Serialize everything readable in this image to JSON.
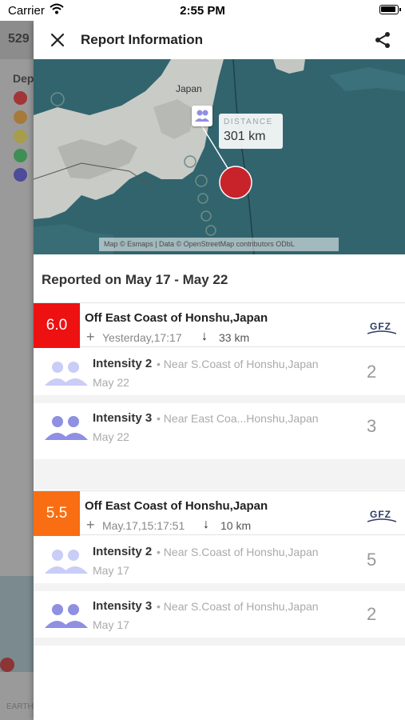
{
  "status_bar": {
    "carrier": "Carrier",
    "time": "2:55 PM"
  },
  "background_app": {
    "count": "529",
    "legend_title": "Dep",
    "legend_colors": [
      "#a23636",
      "#a77a3c",
      "#a79d4a",
      "#3f8e54",
      "#4e4b9a"
    ],
    "footer": "EARTH"
  },
  "header": {
    "title": "Report Information"
  },
  "map": {
    "place_label": "Japan",
    "distance_label": "DISTANCE",
    "distance_value": "301 km",
    "attribution": "Map © Esmaps | Data © OpenStreetMap contributors ODbL"
  },
  "reported_heading": "Reported on May 17 - May 22",
  "colors": {
    "mag_6": "#ee1111",
    "mag_5": "#f96e12",
    "intensity_2": "#c9cdf7",
    "intensity_3": "#8f8fe3"
  },
  "quakes": [
    {
      "magnitude": "6.0",
      "place": "Off East Coast of Honshu,Japan",
      "time": "Yesterday,17:17",
      "depth": "33 km",
      "source": "GFZ",
      "reports": [
        {
          "intensity": "Intensity 2",
          "location": "Near S.Coast of Honshu,Japan",
          "date": "May 22",
          "count": "2"
        },
        {
          "intensity": "Intensity 3",
          "location": "Near East Coa...Honshu,Japan",
          "date": "May 22",
          "count": "3"
        }
      ]
    },
    {
      "magnitude": "5.5",
      "place": "Off East Coast of Honshu,Japan",
      "time": "May.17,15:17:51",
      "depth": "10 km",
      "source": "GFZ",
      "reports": [
        {
          "intensity": "Intensity 2",
          "location": "Near S.Coast of Honshu,Japan",
          "date": "May 17",
          "count": "5"
        },
        {
          "intensity": "Intensity 3",
          "location": "Near S.Coast of Honshu,Japan",
          "date": "May 17",
          "count": "2"
        }
      ]
    }
  ]
}
